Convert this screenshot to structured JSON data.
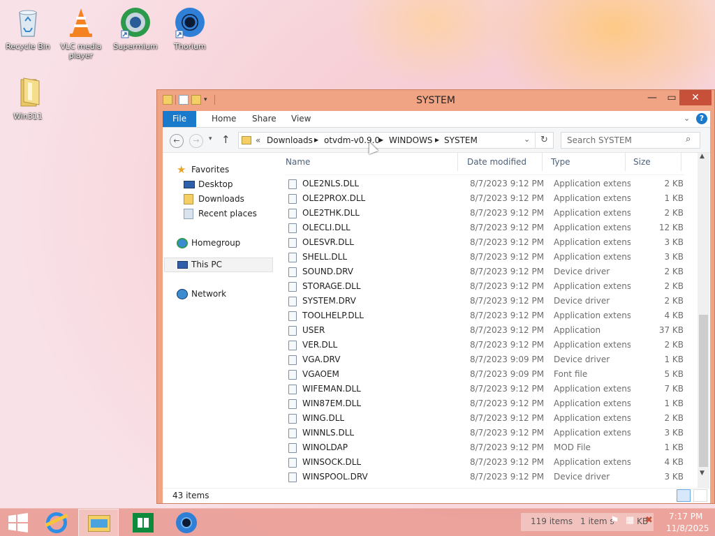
{
  "desktop": {
    "icons": [
      {
        "label": "Recycle Bin",
        "icon": "recycle-bin-icon"
      },
      {
        "label": "VLC media player",
        "icon": "vlc-icon"
      },
      {
        "label": "Supermium",
        "icon": "supermium-icon"
      },
      {
        "label": "Thorium",
        "icon": "thorium-icon"
      },
      {
        "label": "Win311",
        "icon": "folder-icon"
      }
    ]
  },
  "window": {
    "title": "SYSTEM",
    "ribbon_tabs": [
      "File",
      "Home",
      "Share",
      "View"
    ],
    "breadcrumb": {
      "prefix": "«",
      "parts": [
        "Downloads",
        "otvdm-v0.9.0",
        "WINDOWS",
        "SYSTEM"
      ]
    },
    "search_placeholder": "Search SYSTEM",
    "nav": {
      "favorites": "Favorites",
      "desktop": "Desktop",
      "downloads": "Downloads",
      "recent": "Recent places",
      "homegroup": "Homegroup",
      "this_pc": "This PC",
      "network": "Network"
    },
    "columns": [
      "Name",
      "Date modified",
      "Type",
      "Size"
    ],
    "files": [
      {
        "name": "OLE2NLS.DLL",
        "date": "8/7/2023 9:12 PM",
        "type": "Application extens...",
        "size": "2 KB"
      },
      {
        "name": "OLE2PROX.DLL",
        "date": "8/7/2023 9:12 PM",
        "type": "Application extens...",
        "size": "1 KB"
      },
      {
        "name": "OLE2THK.DLL",
        "date": "8/7/2023 9:12 PM",
        "type": "Application extens...",
        "size": "2 KB"
      },
      {
        "name": "OLECLI.DLL",
        "date": "8/7/2023 9:12 PM",
        "type": "Application extens...",
        "size": "12 KB"
      },
      {
        "name": "OLESVR.DLL",
        "date": "8/7/2023 9:12 PM",
        "type": "Application extens...",
        "size": "3 KB"
      },
      {
        "name": "SHELL.DLL",
        "date": "8/7/2023 9:12 PM",
        "type": "Application extens...",
        "size": "3 KB"
      },
      {
        "name": "SOUND.DRV",
        "date": "8/7/2023 9:12 PM",
        "type": "Device driver",
        "size": "2 KB"
      },
      {
        "name": "STORAGE.DLL",
        "date": "8/7/2023 9:12 PM",
        "type": "Application extens...",
        "size": "2 KB"
      },
      {
        "name": "SYSTEM.DRV",
        "date": "8/7/2023 9:12 PM",
        "type": "Device driver",
        "size": "2 KB"
      },
      {
        "name": "TOOLHELP.DLL",
        "date": "8/7/2023 9:12 PM",
        "type": "Application extens...",
        "size": "4 KB"
      },
      {
        "name": "USER",
        "date": "8/7/2023 9:12 PM",
        "type": "Application",
        "size": "37 KB"
      },
      {
        "name": "VER.DLL",
        "date": "8/7/2023 9:12 PM",
        "type": "Application extens...",
        "size": "2 KB"
      },
      {
        "name": "VGA.DRV",
        "date": "8/7/2023 9:09 PM",
        "type": "Device driver",
        "size": "1 KB"
      },
      {
        "name": "VGAOEM",
        "date": "8/7/2023 9:09 PM",
        "type": "Font file",
        "size": "5 KB"
      },
      {
        "name": "WIFEMAN.DLL",
        "date": "8/7/2023 9:12 PM",
        "type": "Application extens...",
        "size": "7 KB"
      },
      {
        "name": "WIN87EM.DLL",
        "date": "8/7/2023 9:12 PM",
        "type": "Application extens...",
        "size": "1 KB"
      },
      {
        "name": "WING.DLL",
        "date": "8/7/2023 9:12 PM",
        "type": "Application extens...",
        "size": "2 KB"
      },
      {
        "name": "WINNLS.DLL",
        "date": "8/7/2023 9:12 PM",
        "type": "Application extens...",
        "size": "3 KB"
      },
      {
        "name": "WINOLDAP",
        "date": "8/7/2023 9:12 PM",
        "type": "MOD File",
        "size": "1 KB"
      },
      {
        "name": "WINSOCK.DLL",
        "date": "8/7/2023 9:12 PM",
        "type": "Application extens...",
        "size": "4 KB"
      },
      {
        "name": "WINSPOOL.DRV",
        "date": "8/7/2023 9:12 PM",
        "type": "Device driver",
        "size": "3 KB"
      }
    ],
    "status": "43 items"
  },
  "taskbar": {
    "pinned": [
      "start-button",
      "internet-explorer-icon",
      "file-explorer-icon",
      "store-icon",
      "thorium-icon"
    ],
    "tray_items_text": "119 items",
    "tray_selected_text": "1 item s",
    "tray_size_text": "KB",
    "clock_time": "7:17 PM",
    "clock_date": "11/8/2025"
  },
  "colors": {
    "window_frame": "#f1a484",
    "file_tab": "#1979ca",
    "close_button": "#c7503a"
  }
}
